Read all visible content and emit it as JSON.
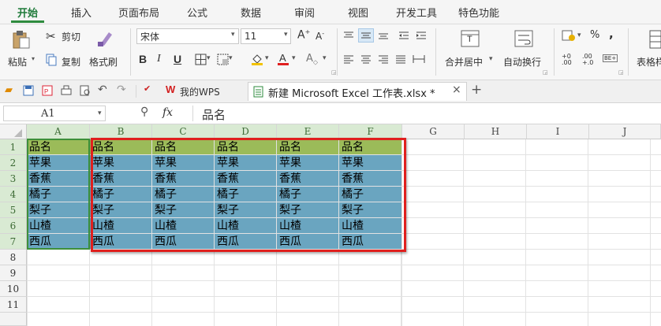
{
  "menu": {
    "tabs": [
      {
        "label": "开始",
        "active": true
      },
      {
        "label": "插入"
      },
      {
        "label": "页面布局"
      },
      {
        "label": "公式"
      },
      {
        "label": "数据"
      },
      {
        "label": "审阅"
      },
      {
        "label": "视图"
      },
      {
        "label": "开发工具"
      },
      {
        "label": "特色功能"
      }
    ]
  },
  "ribbon": {
    "cut": "剪切",
    "copy": "复制",
    "format_painter": "格式刷",
    "paste": "粘贴",
    "font_name": "宋体",
    "font_size": "11",
    "bold": "B",
    "italic": "I",
    "underline": "U",
    "merge_center": "合并居中",
    "auto_wrap": "自动换行",
    "percent": "%",
    "comma": ",",
    "table_style": "表格样"
  },
  "quickbar": {
    "my_wps": "我的WPS",
    "doc_tab": "新建 Microsoft Excel 工作表.xlsx *",
    "close": "×",
    "new_tab": "+"
  },
  "formula": {
    "cell_ref": "A1",
    "fx": "fx",
    "content": "品名"
  },
  "grid": {
    "columns": [
      "A",
      "B",
      "C",
      "D",
      "E",
      "F",
      "G",
      "H",
      "I",
      "J"
    ],
    "rows": [
      "1",
      "2",
      "3",
      "4",
      "5",
      "6",
      "7",
      "8",
      "9",
      "10",
      "11"
    ],
    "header_value": "品名",
    "values": [
      "苹果",
      "香蕉",
      "橘子",
      "梨子",
      "山楂",
      "西瓜"
    ]
  },
  "colors": {
    "header_fill": "#9bbb59",
    "data_fill": "#6aa5c0",
    "highlight_border": "#e0201e",
    "accent": "#2e8b3e"
  }
}
